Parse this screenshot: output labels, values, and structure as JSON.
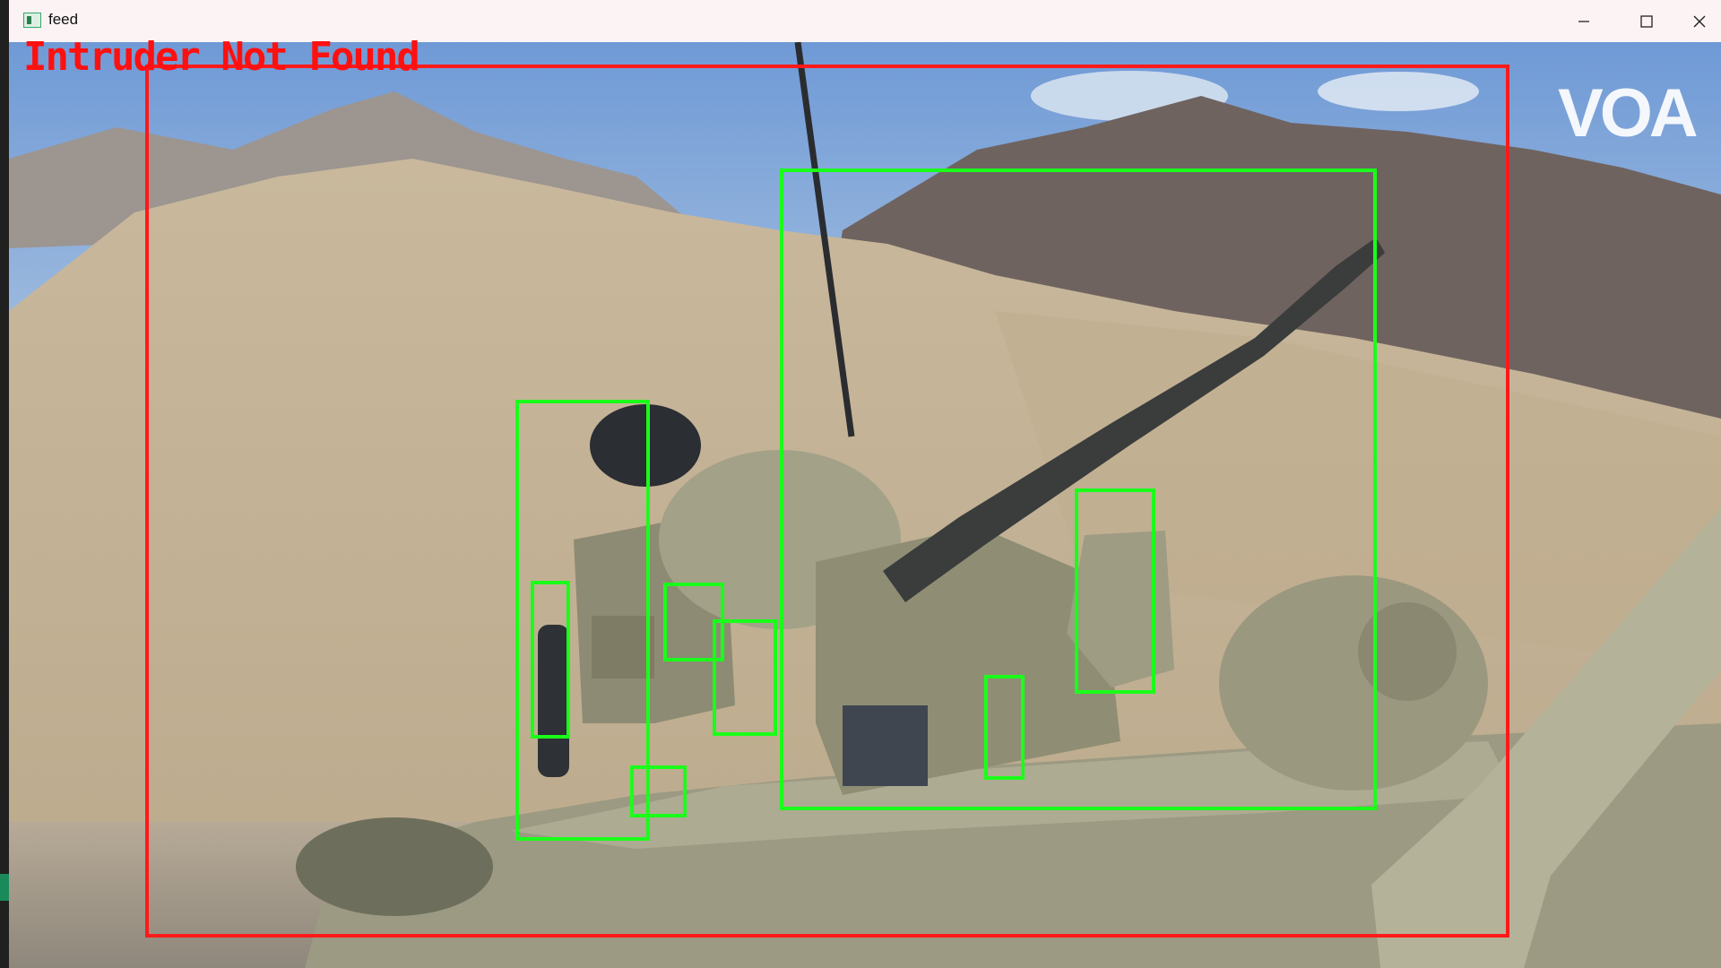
{
  "window": {
    "title": "feed",
    "icon": "app-window-icon",
    "controls": [
      "minimize-icon",
      "maximize-icon",
      "close-icon"
    ]
  },
  "overlay": {
    "status_text": "Intruder Not Found",
    "status_color": "#ff1010",
    "watermark": "VOA",
    "intruder_box_color": "#ff1a1a",
    "detection_box_color": "#1aff1a"
  }
}
